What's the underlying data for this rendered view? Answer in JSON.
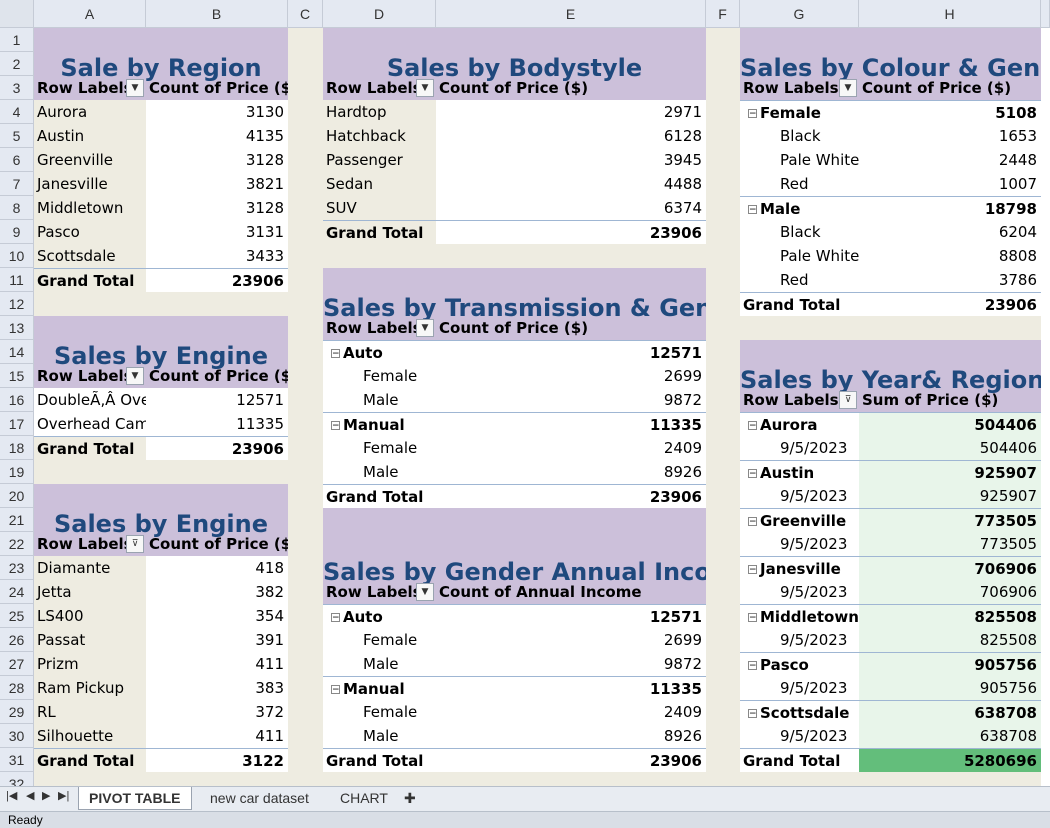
{
  "columns": [
    "A",
    "B",
    "C",
    "D",
    "E",
    "F",
    "G",
    "H"
  ],
  "rows": [
    "1",
    "2",
    "3",
    "4",
    "5",
    "6",
    "7",
    "8",
    "9",
    "10",
    "11",
    "12",
    "13",
    "14",
    "15",
    "16",
    "17",
    "18",
    "19",
    "20",
    "21",
    "22",
    "23",
    "24",
    "25",
    "26",
    "27",
    "28",
    "29",
    "30",
    "31",
    "32"
  ],
  "common": {
    "row_labels": "Row Labels",
    "count_price": "Count of Price ($)",
    "grand_total": "Grand Total"
  },
  "region": {
    "title": "Sale by Region",
    "rows": [
      [
        "Aurora",
        "3130"
      ],
      [
        "Austin",
        "4135"
      ],
      [
        "Greenville",
        "3128"
      ],
      [
        "Janesville",
        "3821"
      ],
      [
        "Middletown",
        "3128"
      ],
      [
        "Pasco",
        "3131"
      ],
      [
        "Scottsdale",
        "3433"
      ]
    ],
    "total": "23906"
  },
  "engine1": {
    "title": "Sales by Engine",
    "rows": [
      [
        "DoubleÃ‚Â Ove",
        "12571"
      ],
      [
        "Overhead Cam",
        "11335"
      ]
    ],
    "total": "23906"
  },
  "engine2": {
    "title": "Sales by Engine",
    "rows": [
      [
        "Diamante",
        "418"
      ],
      [
        "Jetta",
        "382"
      ],
      [
        "LS400",
        "354"
      ],
      [
        "Passat",
        "391"
      ],
      [
        "Prizm",
        "411"
      ],
      [
        "Ram Pickup",
        "383"
      ],
      [
        "RL",
        "372"
      ],
      [
        "Silhouette",
        "411"
      ]
    ],
    "total": "3122"
  },
  "bodystyle": {
    "title": "Sales by Bodystyle",
    "rows": [
      [
        "Hardtop",
        "2971"
      ],
      [
        "Hatchback",
        "6128"
      ],
      [
        "Passenger",
        "3945"
      ],
      [
        "Sedan",
        "4488"
      ],
      [
        "SUV",
        "6374"
      ]
    ],
    "total": "23906"
  },
  "transmission": {
    "title": "Sales by Transmission & Gender",
    "groups": [
      {
        "label": "Auto",
        "value": "12571",
        "children": [
          [
            "Female",
            "2699"
          ],
          [
            "Male",
            "9872"
          ]
        ]
      },
      {
        "label": "Manual",
        "value": "11335",
        "children": [
          [
            "Female",
            "2409"
          ],
          [
            "Male",
            "8926"
          ]
        ]
      }
    ],
    "total": "23906"
  },
  "income": {
    "title": "Sales by Gender Annual Income",
    "value_header": "Count of Annual Income",
    "groups": [
      {
        "label": "Auto",
        "value": "12571",
        "children": [
          [
            "Female",
            "2699"
          ],
          [
            "Male",
            "9872"
          ]
        ]
      },
      {
        "label": "Manual",
        "value": "11335",
        "children": [
          [
            "Female",
            "2409"
          ],
          [
            "Male",
            "8926"
          ]
        ]
      }
    ],
    "total": "23906"
  },
  "colour": {
    "title": "Sales by Colour & Gender",
    "groups": [
      {
        "label": "Female",
        "value": "5108",
        "children": [
          [
            "Black",
            "1653"
          ],
          [
            "Pale White",
            "2448"
          ],
          [
            "Red",
            "1007"
          ]
        ]
      },
      {
        "label": "Male",
        "value": "18798",
        "children": [
          [
            "Black",
            "6204"
          ],
          [
            "Pale White",
            "8808"
          ],
          [
            "Red",
            "3786"
          ]
        ]
      }
    ],
    "total": "23906"
  },
  "year_region": {
    "title": "Sales by Year& Region",
    "value_header": "Sum of Price ($)",
    "groups": [
      {
        "label": "Aurora",
        "value": "504406",
        "children": [
          [
            "9/5/2023",
            "504406"
          ]
        ]
      },
      {
        "label": "Austin",
        "value": "925907",
        "children": [
          [
            "9/5/2023",
            "925907"
          ]
        ]
      },
      {
        "label": "Greenville",
        "value": "773505",
        "children": [
          [
            "9/5/2023",
            "773505"
          ]
        ]
      },
      {
        "label": "Janesville",
        "value": "706906",
        "children": [
          [
            "9/5/2023",
            "706906"
          ]
        ]
      },
      {
        "label": "Middletown",
        "value": "825508",
        "children": [
          [
            "9/5/2023",
            "825508"
          ]
        ]
      },
      {
        "label": "Pasco",
        "value": "905756",
        "children": [
          [
            "9/5/2023",
            "905756"
          ]
        ]
      },
      {
        "label": "Scottsdale",
        "value": "638708",
        "children": [
          [
            "9/5/2023",
            "638708"
          ]
        ]
      }
    ],
    "total": "5280696"
  },
  "tabs": [
    "PIVOT TABLE",
    "new car dataset",
    "CHART"
  ],
  "status": "Ready",
  "colors": {
    "title_band": "#ccc0da",
    "label_band": "#eeece1",
    "title_text": "#1f497d",
    "heat_light": "#e8f5ea",
    "heat_total": "#63be7b"
  }
}
